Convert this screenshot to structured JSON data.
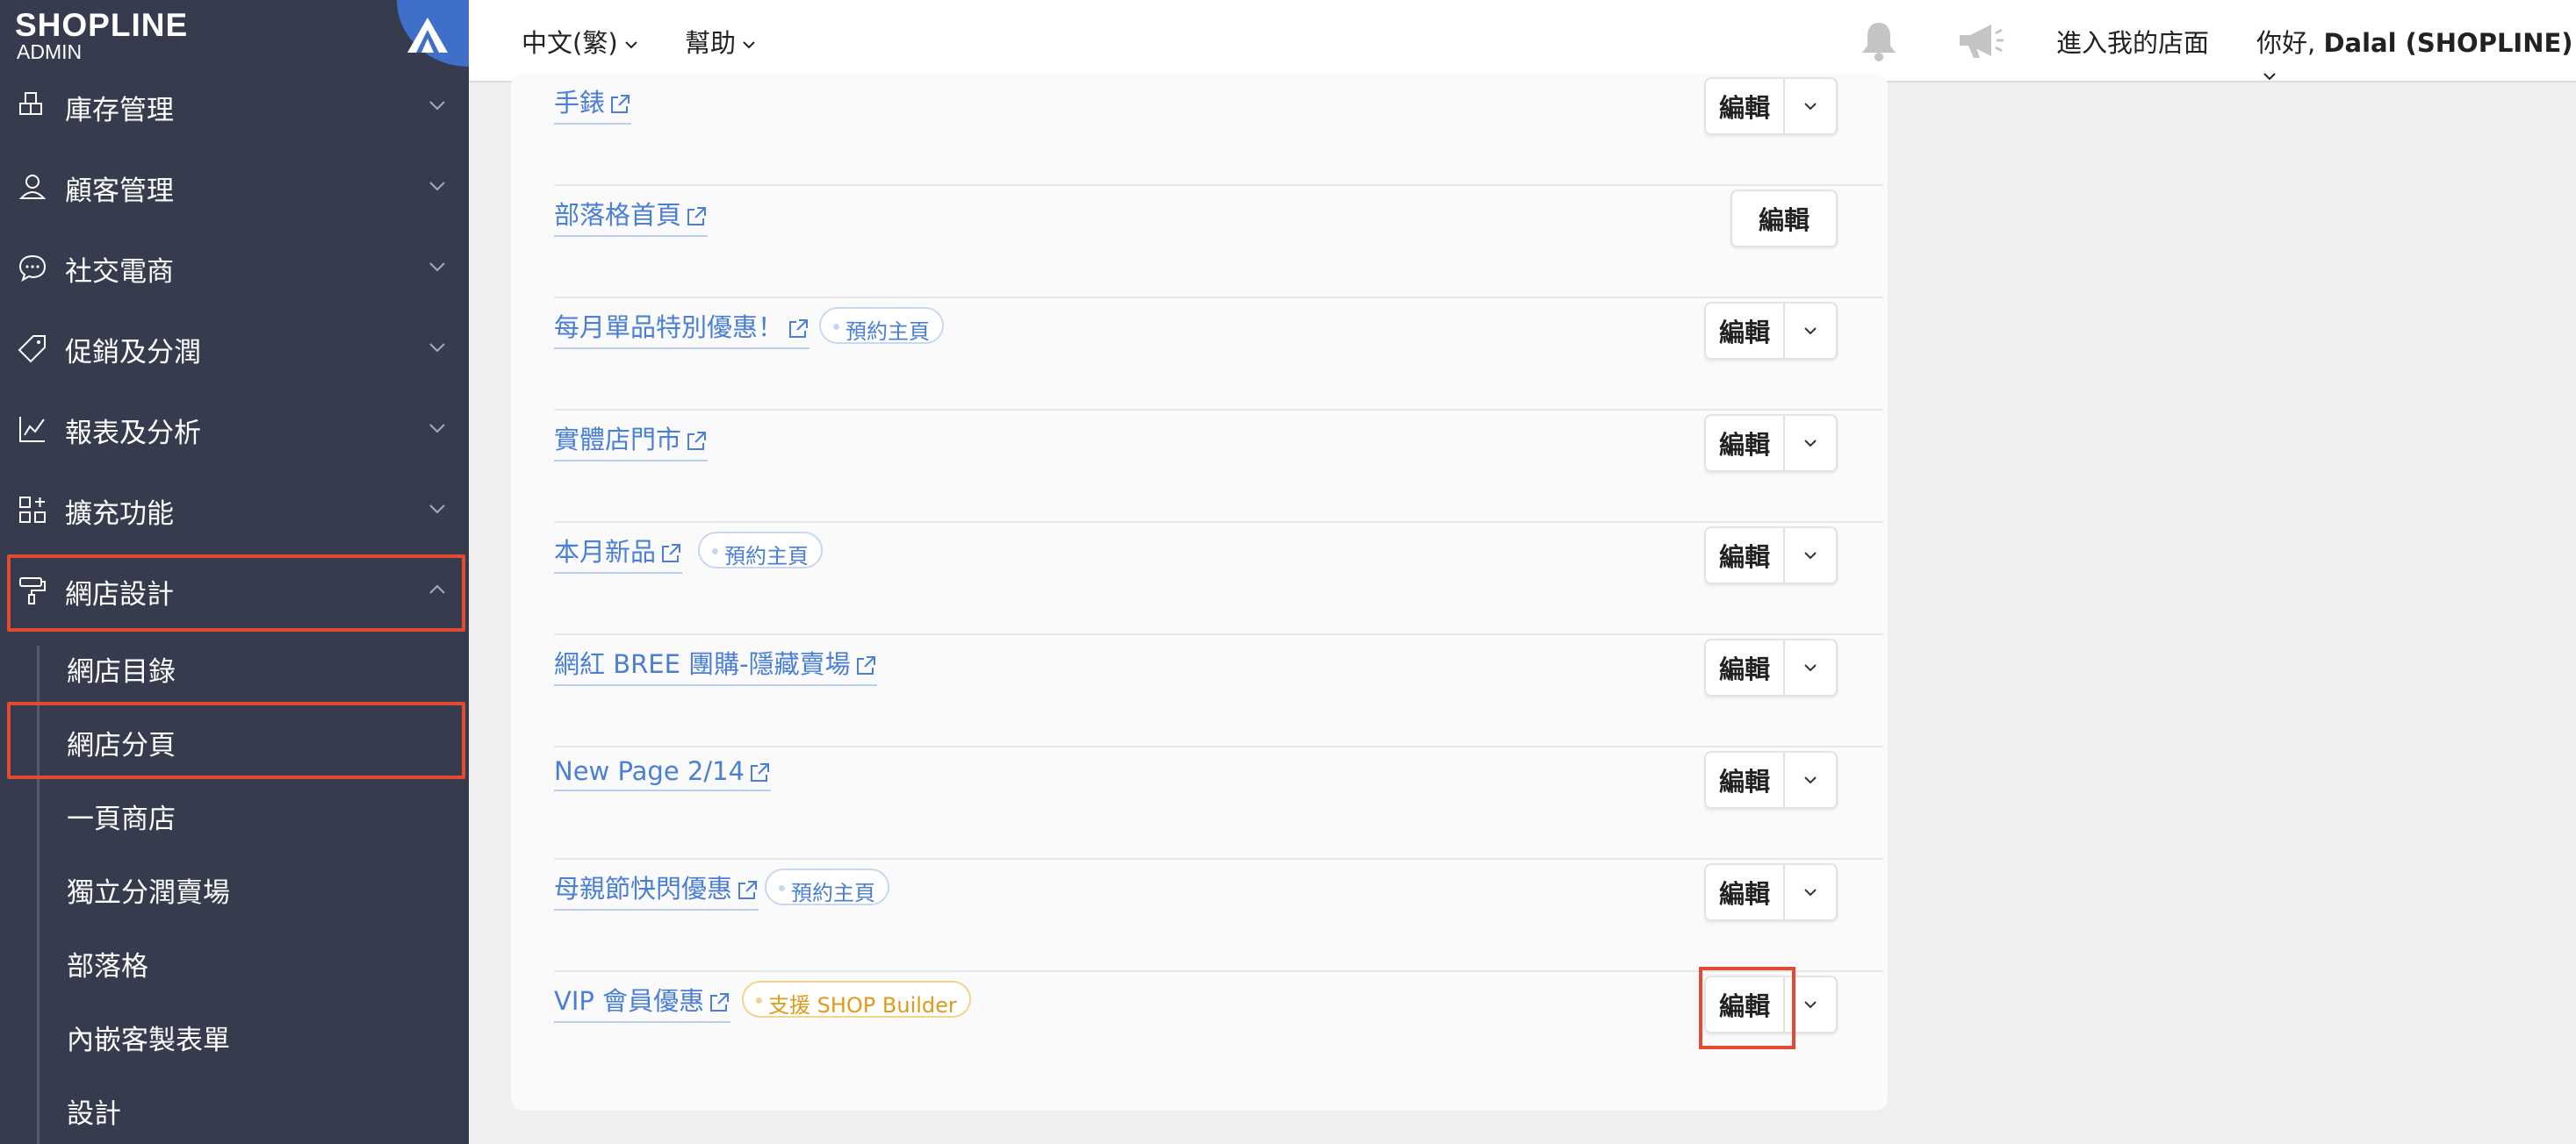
{
  "brand": {
    "name": "SHOPLINE",
    "sub": "ADMIN"
  },
  "sidebar": {
    "items": [
      {
        "label": "庫存管理",
        "icon": "inventory-icon"
      },
      {
        "label": "顧客管理",
        "icon": "customer-icon"
      },
      {
        "label": "社交電商",
        "icon": "chat-icon"
      },
      {
        "label": "促銷及分潤",
        "icon": "tag-icon"
      },
      {
        "label": "報表及分析",
        "icon": "chart-icon"
      },
      {
        "label": "擴充功能",
        "icon": "apps-icon"
      },
      {
        "label": "網店設計",
        "icon": "paint-roller-icon"
      }
    ],
    "subitems": [
      "網店目錄",
      "網店分頁",
      "一頁商店",
      "獨立分潤賣場",
      "部落格",
      "內嵌客製表單",
      "設計"
    ]
  },
  "topbar": {
    "language": "中文(繁)",
    "help": "幫助",
    "visit_store": "進入我的店面",
    "greeting": "你好,",
    "user": "Dalal (SHOPLINE)"
  },
  "pages": [
    {
      "name": "手錶",
      "badge": null,
      "dropdown": true
    },
    {
      "name": "部落格首頁",
      "badge": null,
      "dropdown": false
    },
    {
      "name": "每月單品特別優惠！",
      "badge": "預約主頁",
      "dropdown": true
    },
    {
      "name": "實體店門市",
      "badge": null,
      "dropdown": true
    },
    {
      "name": "本月新品",
      "badge": "預約主頁",
      "dropdown": true
    },
    {
      "name": "網紅 BREE 團購-隱藏賣場",
      "badge": null,
      "dropdown": true
    },
    {
      "name": "New Page 2/14",
      "badge": null,
      "dropdown": true
    },
    {
      "name": "母親節快閃優惠",
      "badge": "預約主頁",
      "dropdown": true
    },
    {
      "name": "VIP 會員優惠",
      "badge": "支援 SHOP Builder",
      "badge_style": "orange",
      "dropdown": true
    }
  ],
  "edit_label": "編輯",
  "colors": {
    "sidebar_bg": "#363c4d",
    "link": "#4a7fd6",
    "highlight": "#e24b32",
    "accent": "#3f6fc9"
  }
}
